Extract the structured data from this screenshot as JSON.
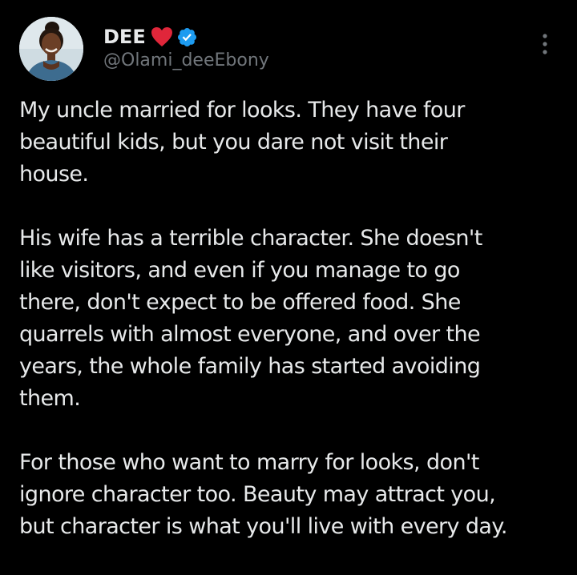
{
  "author": {
    "display_name": "DEE",
    "handle": "@Olami_deeEbony",
    "name_emoji": "heart-icon",
    "verified_badge": "verified-icon",
    "avatar_alt": "profile-photo"
  },
  "tweet": {
    "paragraphs": [
      "My uncle married for looks. They have four\nbeautiful kids, but you dare not visit their\nhouse.",
      "His wife has a terrible character. She doesn't\nlike visitors, and even if you manage to go\nthere, don't expect to be offered food. She\nquarrels with almost everyone, and over the\nyears, the whole family has started avoiding\nthem.",
      "For those who want to marry for looks, don't\nignore character too. Beauty may attract you,\nbut character is what you'll live with every day."
    ]
  },
  "colors": {
    "background": "#000000",
    "text": "#e7e9ea",
    "secondary_text": "#71767b",
    "verified_blue": "#1d9bf0",
    "heart_red": "#e0263a"
  }
}
